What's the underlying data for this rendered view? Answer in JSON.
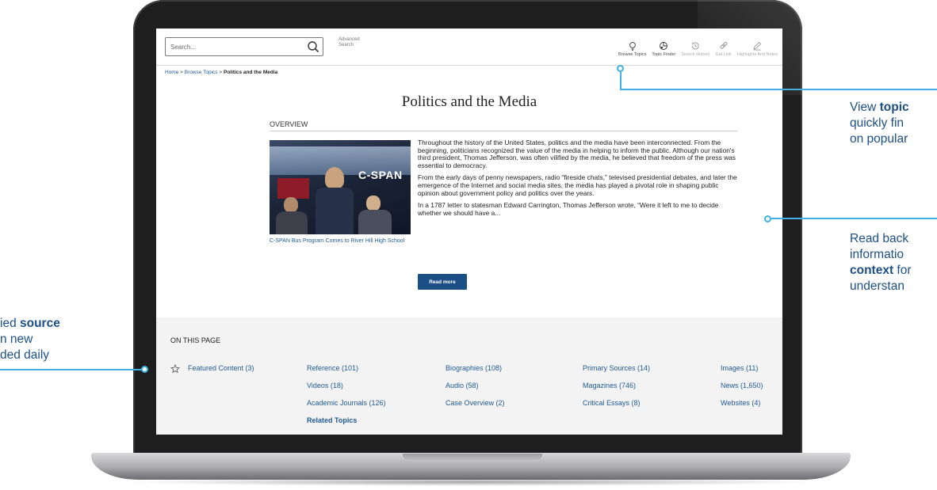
{
  "search": {
    "placeholder": "Search...",
    "advanced_line1": "Advanced",
    "advanced_line2": "Search"
  },
  "tools": [
    {
      "label": "Browse Topics",
      "icon": "lightbulb-icon"
    },
    {
      "label": "Topic Finder",
      "icon": "topic-finder-icon"
    },
    {
      "label": "Search History",
      "icon": "history-icon"
    },
    {
      "label": "Get Link",
      "icon": "link-icon"
    },
    {
      "label": "Highlights And Notes",
      "icon": "pencil-icon"
    }
  ],
  "breadcrumb": {
    "home": "Home",
    "browse": "Browse Topics",
    "current": "Politics and the Media",
    "separator": ">"
  },
  "page": {
    "title": "Politics and the Media",
    "overview_label": "OVERVIEW",
    "image_overlay_text": "C-SPAN",
    "caption": "C-SPAN Bus Program Comes to River Hill High School",
    "paragraphs": [
      "Throughout the history of the United States, politics and the media have been interconnected. From the beginning, politicians recognized the value of the media in helping to inform the public. Although our nation's third president, Thomas Jefferson, was often vilified by the media, he believed that freedom of the press was essential to democracy.",
      "From the early days of penny newspapers, radio “fireside chats,” televised presidential debates, and later the emergence of the Internet and social media sites, the media has played a pivotal role in shaping public opinion about government policy and politics over the years.",
      "In a 1787 letter to statesman Edward Carrington, Thomas Jefferson wrote, “Were it left to me to decide whether we should have a..."
    ],
    "read_more": "Read more"
  },
  "on_this_page": {
    "heading": "ON THIS PAGE",
    "links": {
      "featured": "Featured Content (3)",
      "reference": "Reference (101)",
      "videos": "Videos (18)",
      "academic": "Academic Journals (126)",
      "related": "Related Topics",
      "biographies": "Biographies (108)",
      "audio": "Audio (58)",
      "case_overview": "Case Overview (2)",
      "primary": "Primary Sources (14)",
      "magazines": "Magazines (746)",
      "critical": "Critical Essays (8)",
      "images": "Images (11)",
      "news": "News (1,650)",
      "websites": "Websites (4)"
    }
  },
  "callouts": {
    "right_top": {
      "line1_a": "View ",
      "line1_b": "topic",
      "line2": "quickly fin",
      "line3": "on popular"
    },
    "right_mid": {
      "line1": "Read back",
      "line2": "informatio",
      "line3_b": "context",
      "line3_a": " for",
      "line4": "understan"
    },
    "left": {
      "line1_a": "ied ",
      "line1_b": "source",
      "line2": "n new",
      "line3": "ded daily"
    }
  },
  "colors": {
    "accent": "#3fb1e5",
    "link": "#1f5a92",
    "button": "#1c4f86"
  }
}
